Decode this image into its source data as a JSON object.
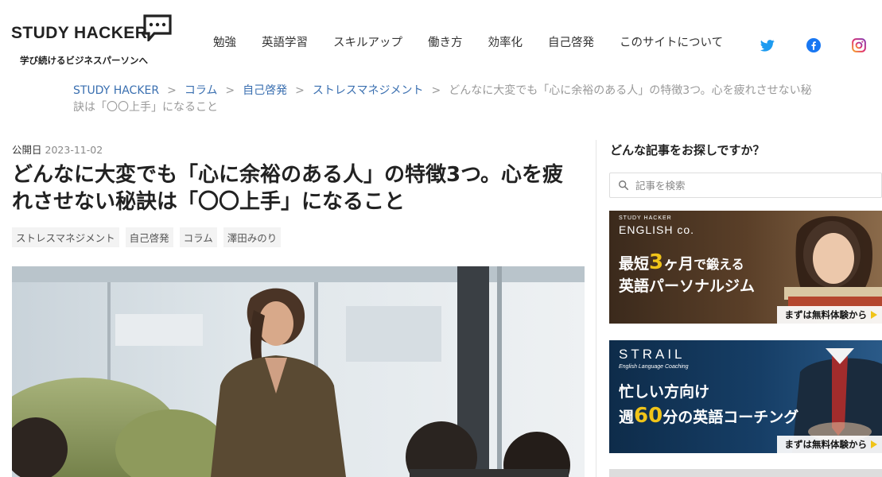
{
  "header": {
    "logo_text": "STUDY HACKER",
    "tagline": "学び続けるビジネスパーソンへ",
    "nav": [
      "勉強",
      "英語学習",
      "スキルアップ",
      "働き方",
      "効率化",
      "自己啓発",
      "このサイトについて"
    ],
    "social": [
      "twitter-icon",
      "facebook-icon",
      "instagram-icon"
    ]
  },
  "breadcrumb": {
    "items": [
      "STUDY HACKER",
      "コラム",
      "自己啓発",
      "ストレスマネジメント"
    ],
    "current": "どんなに大変でも「心に余裕のある人」の特徴3つ。心を疲れさせない秘訣は「〇〇上手」になること",
    "separator": ">"
  },
  "article": {
    "pub_label": "公開日",
    "pub_date": "2023-11-02",
    "title": "どんなに大変でも「心に余裕のある人」の特徴3つ。心を疲れさせない秘訣は「〇〇上手」になること",
    "tags": [
      "ストレスマネジメント",
      "自己啓発",
      "コラム",
      "澤田みのり"
    ]
  },
  "sidebar": {
    "heading": "どんな記事をお探しですか？",
    "search_placeholder": "記事を検索",
    "banners": [
      {
        "brand_top": "STUDY HACKER",
        "brand": "ENGLISH co.",
        "line1_pre": "最短",
        "line1_num": "3",
        "line1_mid": "ヶ月",
        "line1_post": "で鍛える",
        "line2": "英語パーソナルジム",
        "cta": "まずは無料体験から"
      },
      {
        "brand": "STRAIL",
        "brand_sub": "English Language Coaching",
        "line1": "忙しい方向け",
        "line2_pre": "週",
        "line2_num": "60",
        "line2_post": "分の英語コーチング",
        "cta": "まずは無料体験から"
      }
    ]
  },
  "colors": {
    "link": "#3a6fb0",
    "accent": "#f0c419",
    "twitter": "#1d9bf0",
    "facebook": "#1877f2"
  }
}
